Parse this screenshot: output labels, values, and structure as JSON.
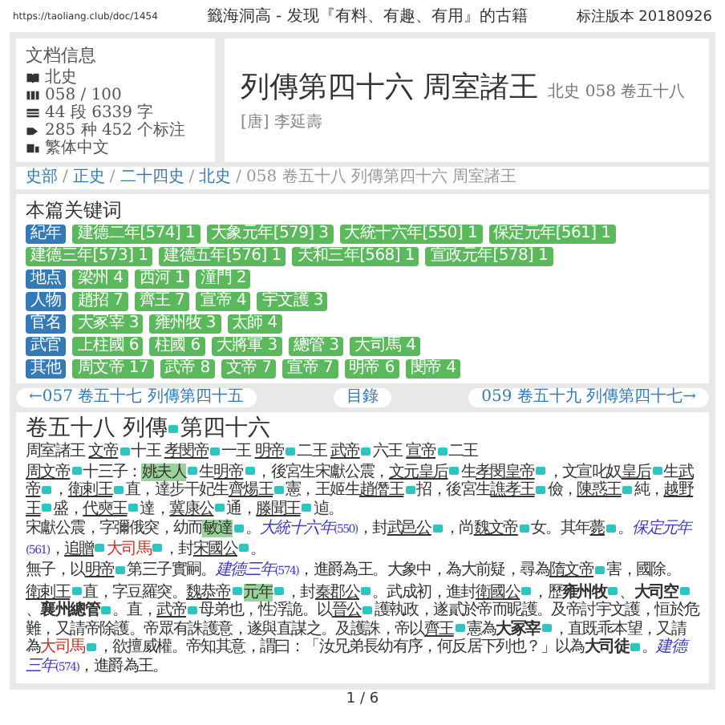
{
  "topbar": {
    "url": "https://taoliang.club/doc/1454",
    "site_title": "籤海洞高 - 发现『有料、有趣、有用』的古籍",
    "version": "标注版本 20180926"
  },
  "doc_info": {
    "heading": "文档信息",
    "items": [
      {
        "kind": "book",
        "text": "北史"
      },
      {
        "kind": "index",
        "text": "058 / 100"
      },
      {
        "kind": "count",
        "text": "44 段 6339 字"
      },
      {
        "kind": "tag",
        "text": "285 种 452 个标注"
      },
      {
        "kind": "script",
        "text": "繁体中文"
      }
    ]
  },
  "title": {
    "main": "列傳第四十六 周室諸王",
    "sub": "北史 058 卷五十八",
    "author": "[唐] 李延壽"
  },
  "breadcrumb_separator": "/",
  "breadcrumb": [
    "史部",
    "正史",
    "二十四史",
    "北史",
    "058 卷五十八 列傳第四十六 周室諸王"
  ],
  "keywords": {
    "heading": "本篇关键词",
    "groups": [
      {
        "category": "紀年",
        "tags": [
          "建德二年[574] 1",
          "大象元年[579] 3",
          "大統十六年[550] 1",
          "保定元年[561] 1",
          "建德三年[573] 1",
          "建德五年[576] 1",
          "天和三年[568] 1",
          "宣政元年[578] 1"
        ]
      },
      {
        "category": "地点",
        "tags": [
          "梁州 4",
          "西河 1",
          "潼門 2"
        ]
      },
      {
        "category": "人物",
        "tags": [
          "趙招 7",
          "齊王 7",
          "宣帝 4",
          "宇文護 3"
        ]
      },
      {
        "category": "官名",
        "tags": [
          "大冢宰 3",
          "雍州牧 3",
          "太師 4"
        ]
      },
      {
        "category": "武官",
        "tags": [
          "上柱國 6",
          "柱國 6",
          "大將軍 3",
          "總管 3",
          "大司馬 4"
        ]
      },
      {
        "category": "其他",
        "tags": [
          "周文帝 17",
          "武帝 8",
          "文帝 7",
          "宣帝 7",
          "明帝 6",
          "閔帝 4"
        ]
      }
    ]
  },
  "nav": {
    "prev": "←057 卷五十七 列傳第四十五",
    "toc": "目錄",
    "next": "059 卷五十九 列傳第四十七→"
  },
  "content": {
    "heading": [
      {
        "t": "卷五十八 列傳",
        "kind": "mark"
      },
      {
        "t": "第四十六",
        "kind": "plain"
      }
    ],
    "paragraphs": [
      [
        {
          "t": "周室諸王 ",
          "kind": "plain"
        },
        {
          "t": "文帝",
          "kind": "link"
        },
        {
          "t": "十王 ",
          "kind": "plain"
        },
        {
          "t": "孝閔帝",
          "kind": "link"
        },
        {
          "t": "一王 ",
          "kind": "plain"
        },
        {
          "t": "明帝",
          "kind": "link"
        },
        {
          "t": "二王 ",
          "kind": "plain"
        },
        {
          "t": "武帝",
          "kind": "link"
        },
        {
          "t": "六王 ",
          "kind": "plain"
        },
        {
          "t": "宣帝",
          "kind": "link"
        },
        {
          "t": "二王",
          "kind": "plain"
        }
      ],
      [
        {
          "t": "周文帝",
          "kind": "link"
        },
        {
          "t": "十三子：",
          "kind": "plain"
        },
        {
          "t": "姚夫人",
          "kind": "highlight"
        },
        {
          "t": "生",
          "kind": "plain"
        },
        {
          "t": "明帝",
          "kind": "link"
        },
        {
          "t": "，後宮生宋獻公震，",
          "kind": "plain"
        },
        {
          "t": "文元皇后",
          "kind": "link"
        },
        {
          "t": "生",
          "kind": "plain"
        },
        {
          "t": "孝閔皇帝",
          "kind": "link"
        },
        {
          "t": "，文宣叱奴",
          "kind": "plain"
        },
        {
          "t": "皇后",
          "kind": "link"
        },
        {
          "t": "生",
          "kind": "plain"
        },
        {
          "t": "武帝",
          "kind": "link"
        },
        {
          "t": "，",
          "kind": "plain"
        },
        {
          "t": "衛剌王",
          "kind": "link"
        },
        {
          "t": "直，達步干妃生",
          "kind": "plain"
        },
        {
          "t": "齊煬王",
          "kind": "link"
        },
        {
          "t": "憲，王姬生",
          "kind": "plain"
        },
        {
          "t": "趙僭王",
          "kind": "link"
        },
        {
          "t": "招，後宮生",
          "kind": "plain"
        },
        {
          "t": "譙孝王",
          "kind": "link"
        },
        {
          "t": "儉，",
          "kind": "plain"
        },
        {
          "t": "陳惑王",
          "kind": "link"
        },
        {
          "t": "純，",
          "kind": "plain"
        },
        {
          "t": "越野王",
          "kind": "link"
        },
        {
          "t": "盛，",
          "kind": "plain"
        },
        {
          "t": "代奭王",
          "kind": "link"
        },
        {
          "t": "達，",
          "kind": "plain"
        },
        {
          "t": "冀康公",
          "kind": "link"
        },
        {
          "t": "通，",
          "kind": "plain"
        },
        {
          "t": "滕聞王",
          "kind": "link"
        },
        {
          "t": "逌。",
          "kind": "plain"
        }
      ],
      [
        {
          "t": "宋獻公震，字彌俄突，幼而",
          "kind": "plain"
        },
        {
          "t": "敏達",
          "kind": "highlight"
        },
        {
          "t": "。",
          "kind": "plain"
        },
        {
          "t": "大統十六年",
          "kind": "date"
        },
        {
          "t": "(550)",
          "kind": "small"
        },
        {
          "t": "，封",
          "kind": "plain"
        },
        {
          "t": "武邑公",
          "kind": "link"
        },
        {
          "t": "，尚",
          "kind": "plain"
        },
        {
          "t": "魏文帝",
          "kind": "link"
        },
        {
          "t": "女。其年",
          "kind": "plain"
        },
        {
          "t": "薨",
          "kind": "link"
        },
        {
          "t": "。",
          "kind": "plain"
        },
        {
          "t": "保定元年",
          "kind": "date"
        },
        {
          "t": "(561)",
          "kind": "small"
        },
        {
          "t": "，",
          "kind": "plain"
        },
        {
          "t": "追贈",
          "kind": "link"
        },
        {
          "t": "大司馬",
          "kind": "office"
        },
        {
          "t": "，封",
          "kind": "plain"
        },
        {
          "t": "宋國公",
          "kind": "link"
        },
        {
          "t": "。",
          "kind": "plain"
        }
      ],
      [
        {
          "t": "無子，以",
          "kind": "plain"
        },
        {
          "t": "明帝",
          "kind": "link"
        },
        {
          "t": "第三子實嗣。",
          "kind": "plain"
        },
        {
          "t": "建德三年",
          "kind": "date"
        },
        {
          "t": "(574)",
          "kind": "small"
        },
        {
          "t": "，進爵為王。大象中，為大前疑，尋為",
          "kind": "plain"
        },
        {
          "t": "隋文帝",
          "kind": "link"
        },
        {
          "t": "害，國除。",
          "kind": "plain"
        }
      ],
      [
        {
          "t": "衛剌王",
          "kind": "link"
        },
        {
          "t": "直，字豆羅突。",
          "kind": "plain"
        },
        {
          "t": "魏恭帝",
          "kind": "link"
        },
        {
          "t": "元年",
          "kind": "highlight"
        },
        {
          "t": "，封",
          "kind": "plain"
        },
        {
          "t": "秦郡公",
          "kind": "link"
        },
        {
          "t": "。武成初，進封",
          "kind": "plain"
        },
        {
          "t": "衛國公",
          "kind": "link"
        },
        {
          "t": "，歷",
          "kind": "plain"
        },
        {
          "t": "雍州牧",
          "kind": "bold"
        },
        {
          "t": "、",
          "kind": "plain"
        },
        {
          "t": "大司空",
          "kind": "bold"
        },
        {
          "t": "、",
          "kind": "plain"
        },
        {
          "t": "襄州總管",
          "kind": "bold"
        },
        {
          "t": "。直，",
          "kind": "plain"
        },
        {
          "t": "武帝",
          "kind": "link"
        },
        {
          "t": "母弟也，性浮詭。以",
          "kind": "plain"
        },
        {
          "t": "晉公",
          "kind": "link"
        },
        {
          "t": "護執政，遂貳於帝而昵護。及帝討宇文護，恒於危難，又請帝除護。帝眾有誅護意，遂與直謀之。及護誅，帝以",
          "kind": "plain"
        },
        {
          "t": "齊王",
          "kind": "link"
        },
        {
          "t": "憲為",
          "kind": "plain"
        },
        {
          "t": "大冢宰",
          "kind": "bold"
        },
        {
          "t": "，直既乖本望，又請為",
          "kind": "plain"
        },
        {
          "t": "大司馬",
          "kind": "office"
        },
        {
          "t": "，欲擅威權。帝知其意，謂曰：「汝兄弟長幼有序，何反居下列也？」以為",
          "kind": "plain"
        },
        {
          "t": "大司徒",
          "kind": "bold"
        },
        {
          "t": "。",
          "kind": "plain"
        },
        {
          "t": "建德三年",
          "kind": "date"
        },
        {
          "t": "(574)",
          "kind": "small"
        },
        {
          "t": "，進爵為王。",
          "kind": "plain"
        }
      ]
    ]
  },
  "pager": "1 / 6"
}
